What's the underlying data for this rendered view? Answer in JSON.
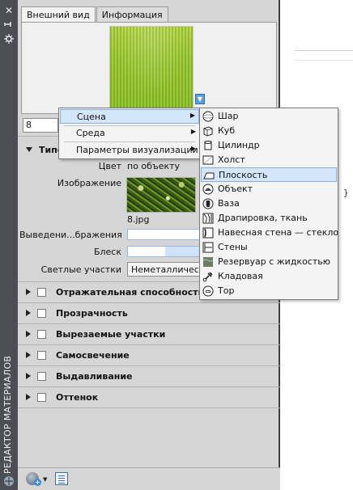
{
  "palette": {
    "title": "РЕДАКТОР МАТЕРИАЛОВ",
    "tabs": [
      "Внешний вид",
      "Информация"
    ],
    "preview_dropdown_glyph": "▼",
    "field_value": "8"
  },
  "sections": {
    "generic": {
      "heading": "Типо",
      "color_label": "Цвет",
      "color_value": "по объекту",
      "image_label": "Изображение",
      "image_filename": "8.jpg",
      "fade_label": "Выведени...бражения",
      "fade_level": 1.0,
      "glossiness_label": "Блеск",
      "glossiness_level": 0.4,
      "highlights_label": "Светлые участки",
      "highlights_value": "Неметаллическ"
    },
    "collapsed": [
      "Отражательная способность",
      "Прозрачность",
      "Вырезаемые участки",
      "Самосвечение",
      "Выдавливание",
      "Оттенок"
    ]
  },
  "context_menu": {
    "items": [
      {
        "label": "Сцена",
        "has_submenu": true,
        "selected": true
      },
      {
        "label": "Среда",
        "has_submenu": true,
        "selected": false
      },
      {
        "label": "Параметры визуализации",
        "has_submenu": true,
        "selected": false
      }
    ],
    "arrow_glyph": "▶"
  },
  "scene_submenu": {
    "items": [
      {
        "label": "Шар",
        "icon": "sphere-icon"
      },
      {
        "label": "Куб",
        "icon": "cube-icon"
      },
      {
        "label": "Цилиндр",
        "icon": "cylinder-icon"
      },
      {
        "label": "Холст",
        "icon": "canvas-icon"
      },
      {
        "label": "Плоскость",
        "icon": "plane-icon",
        "selected": true
      },
      {
        "label": "Объект",
        "icon": "object-icon"
      },
      {
        "label": "Ваза",
        "icon": "vase-icon"
      },
      {
        "label": "Драпировка, ткань",
        "icon": "drapery-icon"
      },
      {
        "label": "Навесная стена — стекло",
        "icon": "curtain-wall-icon"
      },
      {
        "label": "Стены",
        "icon": "walls-icon"
      },
      {
        "label": "Резервуар с жидкостью",
        "icon": "liquid-pool-icon"
      },
      {
        "label": "Кладовая",
        "icon": "utility-icon"
      },
      {
        "label": "Тор",
        "icon": "torus-icon"
      }
    ]
  },
  "background": {
    "text_fragment": "}"
  },
  "colors": {
    "titlebar": "#4b4f55",
    "panel": "#d6d6d6",
    "menu_highlight": "#d4e6fa",
    "accent": "#3a8de0"
  }
}
